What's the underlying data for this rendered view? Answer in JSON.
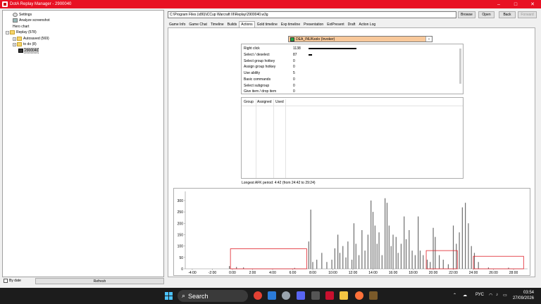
{
  "window": {
    "title": "DotA Replay Manager - 2900040",
    "minimize": "–",
    "maximize": "□",
    "close": "✕"
  },
  "tree": {
    "items": [
      {
        "label": "Settings",
        "icon": "gear-icon"
      },
      {
        "label": "Analyze screenshot",
        "icon": "camera-icon"
      },
      {
        "label": "Hero chart",
        "icon": "chart-icon"
      },
      {
        "label": "Replay (578)",
        "icon": "folder-icon"
      },
      {
        "label": "Autosaved (569)",
        "icon": "folder-icon"
      },
      {
        "label": "to do (8)",
        "icon": "folder-icon"
      },
      {
        "label": "2900040",
        "icon": "replay-file-icon"
      }
    ]
  },
  "footer": {
    "by_date": "By date",
    "refresh": "Refresh"
  },
  "toolbar": {
    "path": "C:\\Program Files (x86)\\iCCup Warcraft III\\Replay\\2900040.w3g",
    "browse": "Browse",
    "open": "Open",
    "back": "Back",
    "forward": "Forward"
  },
  "tabs": [
    "Game Info",
    "Game Chat",
    "Timeline",
    "Builds",
    "Actions",
    "Gold timeline",
    "Exp timeline",
    "Presentation",
    "ExtPresent",
    "Draft",
    "Action Log"
  ],
  "active_tab": "Actions",
  "player_select": {
    "value": "DEA_INUKsolo (Invoker)",
    "arrow": "⌄"
  },
  "actions": [
    {
      "label": "Right click",
      "value": "1138",
      "fraction": 1.0
    },
    {
      "label": "Select / deselect",
      "value": "87",
      "fraction": 0.076
    },
    {
      "label": "Select group hotkey",
      "value": "0",
      "fraction": 0
    },
    {
      "label": "Assign group hotkey",
      "value": "0",
      "fraction": 0
    },
    {
      "label": "Use ability",
      "value": "5",
      "fraction": 0.004
    },
    {
      "label": "Basic commands",
      "value": "0",
      "fraction": 0
    },
    {
      "label": "Select subgroup",
      "value": "0",
      "fraction": 0
    },
    {
      "label": "Give item / drop item",
      "value": "0",
      "fraction": 0
    }
  ],
  "groups_header": [
    "Group",
    "Assigned",
    "Used"
  ],
  "afk": "Longest AFK period: 4:42 (from 24:42 to 29:24)",
  "chart_data": {
    "type": "bar",
    "x_ticks": [
      "-4:00",
      "-2:00",
      "0:00",
      "2:00",
      "4:00",
      "6:00",
      "8:00",
      "10:00",
      "12:00",
      "14:00",
      "16:00",
      "18:00",
      "20:00",
      "22:00",
      "24:00",
      "26:00",
      "28:00"
    ],
    "x_tick_values": [
      -4,
      -2,
      0,
      2,
      4,
      6,
      8,
      10,
      12,
      14,
      16,
      18,
      20,
      22,
      24,
      26,
      28
    ],
    "y_ticks": [
      "0",
      "50",
      "100",
      "150",
      "200",
      "250",
      "300"
    ],
    "xlim": [
      -4.7,
      29.4
    ],
    "ylim": [
      0,
      340
    ],
    "bars": [
      [
        -0.3,
        12
      ],
      [
        0.4,
        8
      ],
      [
        1.1,
        6
      ],
      [
        6.2,
        4
      ],
      [
        7.6,
        120
      ],
      [
        7.8,
        260
      ],
      [
        8.0,
        30
      ],
      [
        8.4,
        40
      ],
      [
        8.9,
        70
      ],
      [
        9.4,
        30
      ],
      [
        9.9,
        40
      ],
      [
        10.2,
        90
      ],
      [
        10.5,
        150
      ],
      [
        10.7,
        70
      ],
      [
        11.0,
        100
      ],
      [
        11.3,
        50
      ],
      [
        11.5,
        120
      ],
      [
        11.9,
        40
      ],
      [
        12.1,
        200
      ],
      [
        12.3,
        110
      ],
      [
        12.6,
        60
      ],
      [
        12.9,
        170
      ],
      [
        13.2,
        80
      ],
      [
        13.5,
        150
      ],
      [
        13.8,
        300
      ],
      [
        14.0,
        250
      ],
      [
        14.2,
        190
      ],
      [
        14.4,
        110
      ],
      [
        14.6,
        160
      ],
      [
        14.9,
        60
      ],
      [
        15.2,
        310
      ],
      [
        15.4,
        290
      ],
      [
        15.6,
        190
      ],
      [
        15.8,
        100
      ],
      [
        16.0,
        150
      ],
      [
        16.3,
        140
      ],
      [
        16.5,
        70
      ],
      [
        16.8,
        110
      ],
      [
        17.1,
        230
      ],
      [
        17.3,
        130
      ],
      [
        17.6,
        170
      ],
      [
        17.9,
        80
      ],
      [
        18.2,
        60
      ],
      [
        18.5,
        230
      ],
      [
        18.7,
        80
      ],
      [
        19.0,
        60
      ],
      [
        19.4,
        40
      ],
      [
        19.7,
        30
      ],
      [
        20.0,
        180
      ],
      [
        20.2,
        140
      ],
      [
        20.6,
        60
      ],
      [
        21.0,
        40
      ],
      [
        21.5,
        20
      ],
      [
        22.0,
        190
      ],
      [
        22.3,
        110
      ],
      [
        22.6,
        160
      ],
      [
        22.9,
        270
      ],
      [
        23.2,
        290
      ],
      [
        23.5,
        200
      ],
      [
        23.8,
        100
      ],
      [
        24.1,
        70
      ],
      [
        24.5,
        30
      ],
      [
        25.5,
        6
      ],
      [
        27.5,
        5
      ]
    ],
    "highlights": [
      {
        "x0": -0.2,
        "x1": 7.4,
        "y0": 0,
        "y1": 88
      },
      {
        "x0": 19.3,
        "x1": 22.4,
        "y0": 0,
        "y1": 80
      },
      {
        "x0": 24.0,
        "x1": 29.0,
        "y0": 0,
        "y1": 55
      }
    ],
    "bar_color": "#6e6e6e",
    "highlight_color": "#e0202a"
  },
  "taskbar": {
    "search": "Search",
    "lang": "РУС",
    "time": "03:54",
    "date": "27/09/2026"
  }
}
